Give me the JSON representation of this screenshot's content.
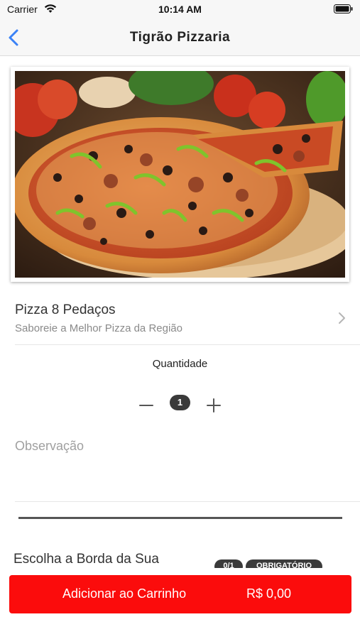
{
  "status_bar": {
    "carrier": "Carrier",
    "time": "10:14 AM",
    "wifi_icon": "wifi-icon",
    "battery_icon": "battery-icon"
  },
  "nav": {
    "title": "Tigrão Pizzaria",
    "back_icon": "chevron-left-icon",
    "accent_color": "#3b82f6"
  },
  "product": {
    "image": "pizza-photo",
    "name": "Pizza 8 Pedaços",
    "description": "Saboreie a Melhor Pizza da Região",
    "chevron_icon": "chevron-right-icon"
  },
  "quantity": {
    "label": "Quantidade",
    "value": "1",
    "minus_icon": "minus-icon",
    "plus_icon": "plus-icon"
  },
  "observation": {
    "placeholder": "Observação",
    "value": ""
  },
  "options_section": {
    "title": "Escolha a Borda da Sua",
    "count_badge": "0/1",
    "required_badge": "OBRIGATÓRIO"
  },
  "cart_button": {
    "label": "Adicionar ao Carrinho",
    "price": "R$ 0,00",
    "color": "#fb0c0c"
  }
}
